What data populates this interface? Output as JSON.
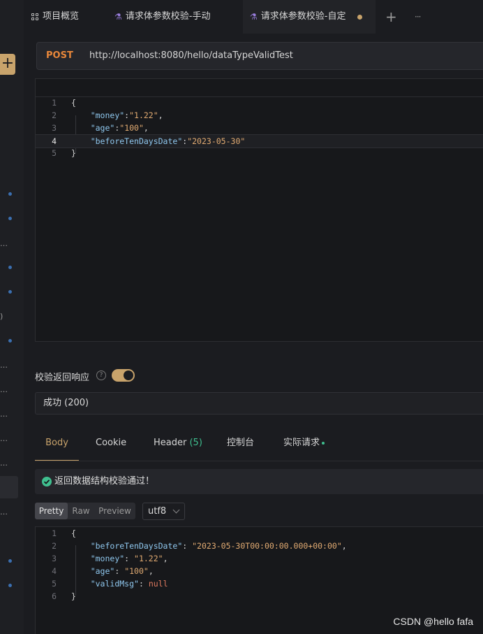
{
  "tabs": [
    {
      "label": "项目概览",
      "icon": "grid-icon"
    },
    {
      "label": "请求体参数校验-手动",
      "icon": "api-icon"
    },
    {
      "label": "请求体参数校验-自定",
      "icon": "api-icon",
      "active": true,
      "unsaved": true
    }
  ],
  "tabbar": {
    "add_symbol": "+",
    "more_symbol": "···"
  },
  "sidebar": {
    "add_symbol": "+"
  },
  "request": {
    "method": "POST",
    "url": "http://localhost:8080/hello/dataTypeValidTest",
    "body_lines": [
      {
        "n": "1",
        "text": "{"
      },
      {
        "n": "2",
        "key": "\"money\"",
        "sep": ":",
        "val": "\"1.22\"",
        "tail": ","
      },
      {
        "n": "3",
        "key": "\"age\"",
        "sep": ":",
        "val": "\"100\"",
        "tail": ","
      },
      {
        "n": "4",
        "key": "\"beforeTenDaysDate\"",
        "sep": ":",
        "val": "\"2023-05-30\"",
        "tail": ""
      },
      {
        "n": "5",
        "text": "}"
      }
    ]
  },
  "validation": {
    "label": "校验返回响应",
    "help_symbol": "?",
    "enabled": true,
    "status_option": "成功 (200)",
    "result_text": "返回数据结构校验通过！"
  },
  "response_tabs": {
    "body": "Body",
    "cookie": "Cookie",
    "header": "Header",
    "header_count": "(5)",
    "console": "控制台",
    "actual_request": "实际请求"
  },
  "format": {
    "pretty": "Pretty",
    "raw": "Raw",
    "preview": "Preview",
    "encoding": "utf8"
  },
  "response": {
    "body_lines": [
      {
        "n": "1",
        "text": "{"
      },
      {
        "n": "2",
        "key": "\"beforeTenDaysDate\"",
        "sep": ": ",
        "val": "\"2023-05-30T00:00:00.000+00:00\"",
        "tail": ","
      },
      {
        "n": "3",
        "key": "\"money\"",
        "sep": ": ",
        "val": "\"1.22\"",
        "tail": ","
      },
      {
        "n": "4",
        "key": "\"age\"",
        "sep": ": ",
        "val": "\"100\"",
        "tail": ","
      },
      {
        "n": "5",
        "key": "\"validMsg\"",
        "sep": ": ",
        "null": "null",
        "tail": ""
      },
      {
        "n": "6",
        "text": "}"
      }
    ]
  },
  "watermark": "CSDN @hello fafa",
  "colors": {
    "accent": "#c8a36b",
    "method": "#e8873a",
    "success": "#3fbf8f",
    "json_key": "#8fc7ee",
    "json_string": "#e2ab72"
  }
}
